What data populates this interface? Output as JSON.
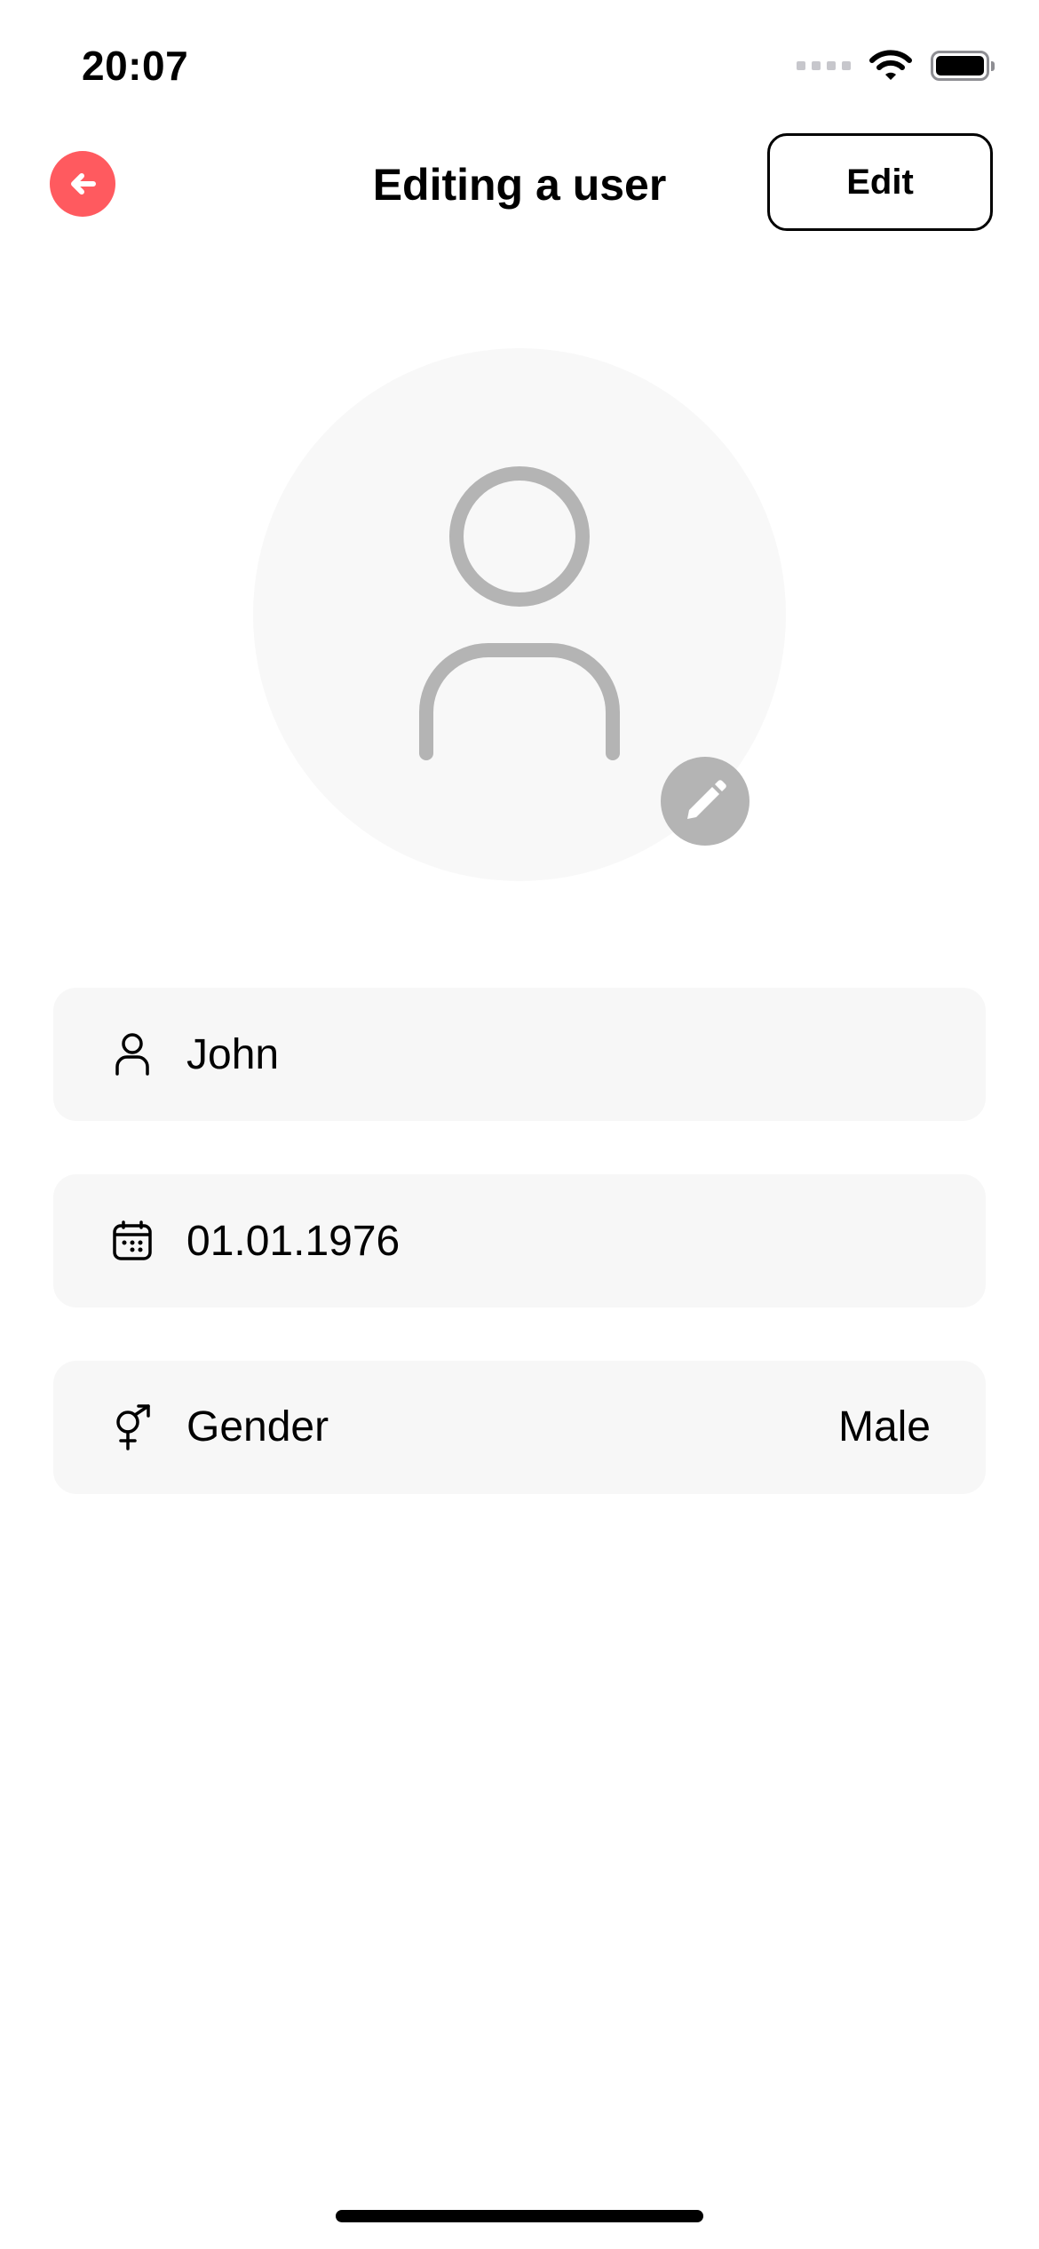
{
  "status_bar": {
    "time": "20:07"
  },
  "header": {
    "title": "Editing a user",
    "edit_label": "Edit",
    "back_icon": "arrow-left-icon"
  },
  "avatar": {
    "placeholder_icon": "person-icon",
    "edit_icon": "pencil-icon"
  },
  "form": {
    "name": {
      "icon": "person-icon",
      "value": "John"
    },
    "birth_date": {
      "icon": "calendar-icon",
      "value": "01.01.1976"
    },
    "gender": {
      "icon": "gender-icon",
      "label": "Gender",
      "value": "Male"
    }
  },
  "colors": {
    "accent": "#ff5a5f",
    "field_background": "#f7f7f7",
    "avatar_background": "#f8f8f8",
    "avatar_icon": "#b4b4b4"
  }
}
